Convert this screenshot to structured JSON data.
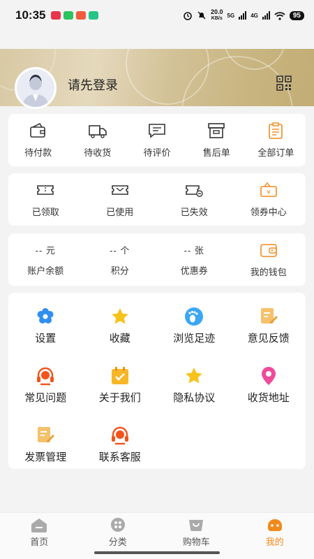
{
  "status": {
    "time": "10:35",
    "net_speed_value": "20.0",
    "net_speed_unit": "KB/s",
    "sig1": "5G",
    "sig2": "4G",
    "battery": "95"
  },
  "header": {
    "login_prompt": "请先登录"
  },
  "orders": [
    {
      "label": "待付款",
      "icon": "wallet-icon"
    },
    {
      "label": "待收货",
      "icon": "truck-icon"
    },
    {
      "label": "待评价",
      "icon": "comment-icon"
    },
    {
      "label": "售后单",
      "icon": "box-icon"
    },
    {
      "label": "全部订单",
      "icon": "clipboard-icon"
    }
  ],
  "coupons": [
    {
      "label": "已领取",
      "icon": "ticket-icon"
    },
    {
      "label": "已使用",
      "icon": "ticket-used-icon"
    },
    {
      "label": "已失效",
      "icon": "ticket-expired-icon"
    },
    {
      "label": "领券中心",
      "icon": "coupon-center-icon"
    }
  ],
  "assets": [
    {
      "value": "-- 元",
      "label": "账户余额"
    },
    {
      "value": "-- 个",
      "label": "积分"
    },
    {
      "value": "-- 张",
      "label": "优惠券"
    },
    {
      "label": "我的钱包",
      "icon": "purse-icon"
    }
  ],
  "services": [
    {
      "label": "设置",
      "icon": "settings-flower-icon"
    },
    {
      "label": "收藏",
      "icon": "star-icon"
    },
    {
      "label": "浏览足迹",
      "icon": "footprint-icon"
    },
    {
      "label": "意见反馈",
      "icon": "feedback-icon"
    },
    {
      "label": "常见问题",
      "icon": "headset-icon"
    },
    {
      "label": "关于我们",
      "icon": "calendar-check-icon"
    },
    {
      "label": "隐私协议",
      "icon": "star-icon"
    },
    {
      "label": "收货地址",
      "icon": "location-pin-icon"
    },
    {
      "label": "发票管理",
      "icon": "invoice-icon"
    },
    {
      "label": "联系客服",
      "icon": "headset-icon"
    }
  ],
  "tabs": [
    {
      "label": "首页",
      "icon": "home-icon",
      "active": false
    },
    {
      "label": "分类",
      "icon": "category-icon",
      "active": false
    },
    {
      "label": "购物车",
      "icon": "cart-icon",
      "active": false
    },
    {
      "label": "我的",
      "icon": "profile-icon",
      "active": true
    }
  ],
  "colors": {
    "accent": "#f08a1c",
    "gold": "#d2c196",
    "blue": "#2f8ff0",
    "yellow": "#f7c21c",
    "red": "#f2541b",
    "pink": "#f04a9a"
  }
}
